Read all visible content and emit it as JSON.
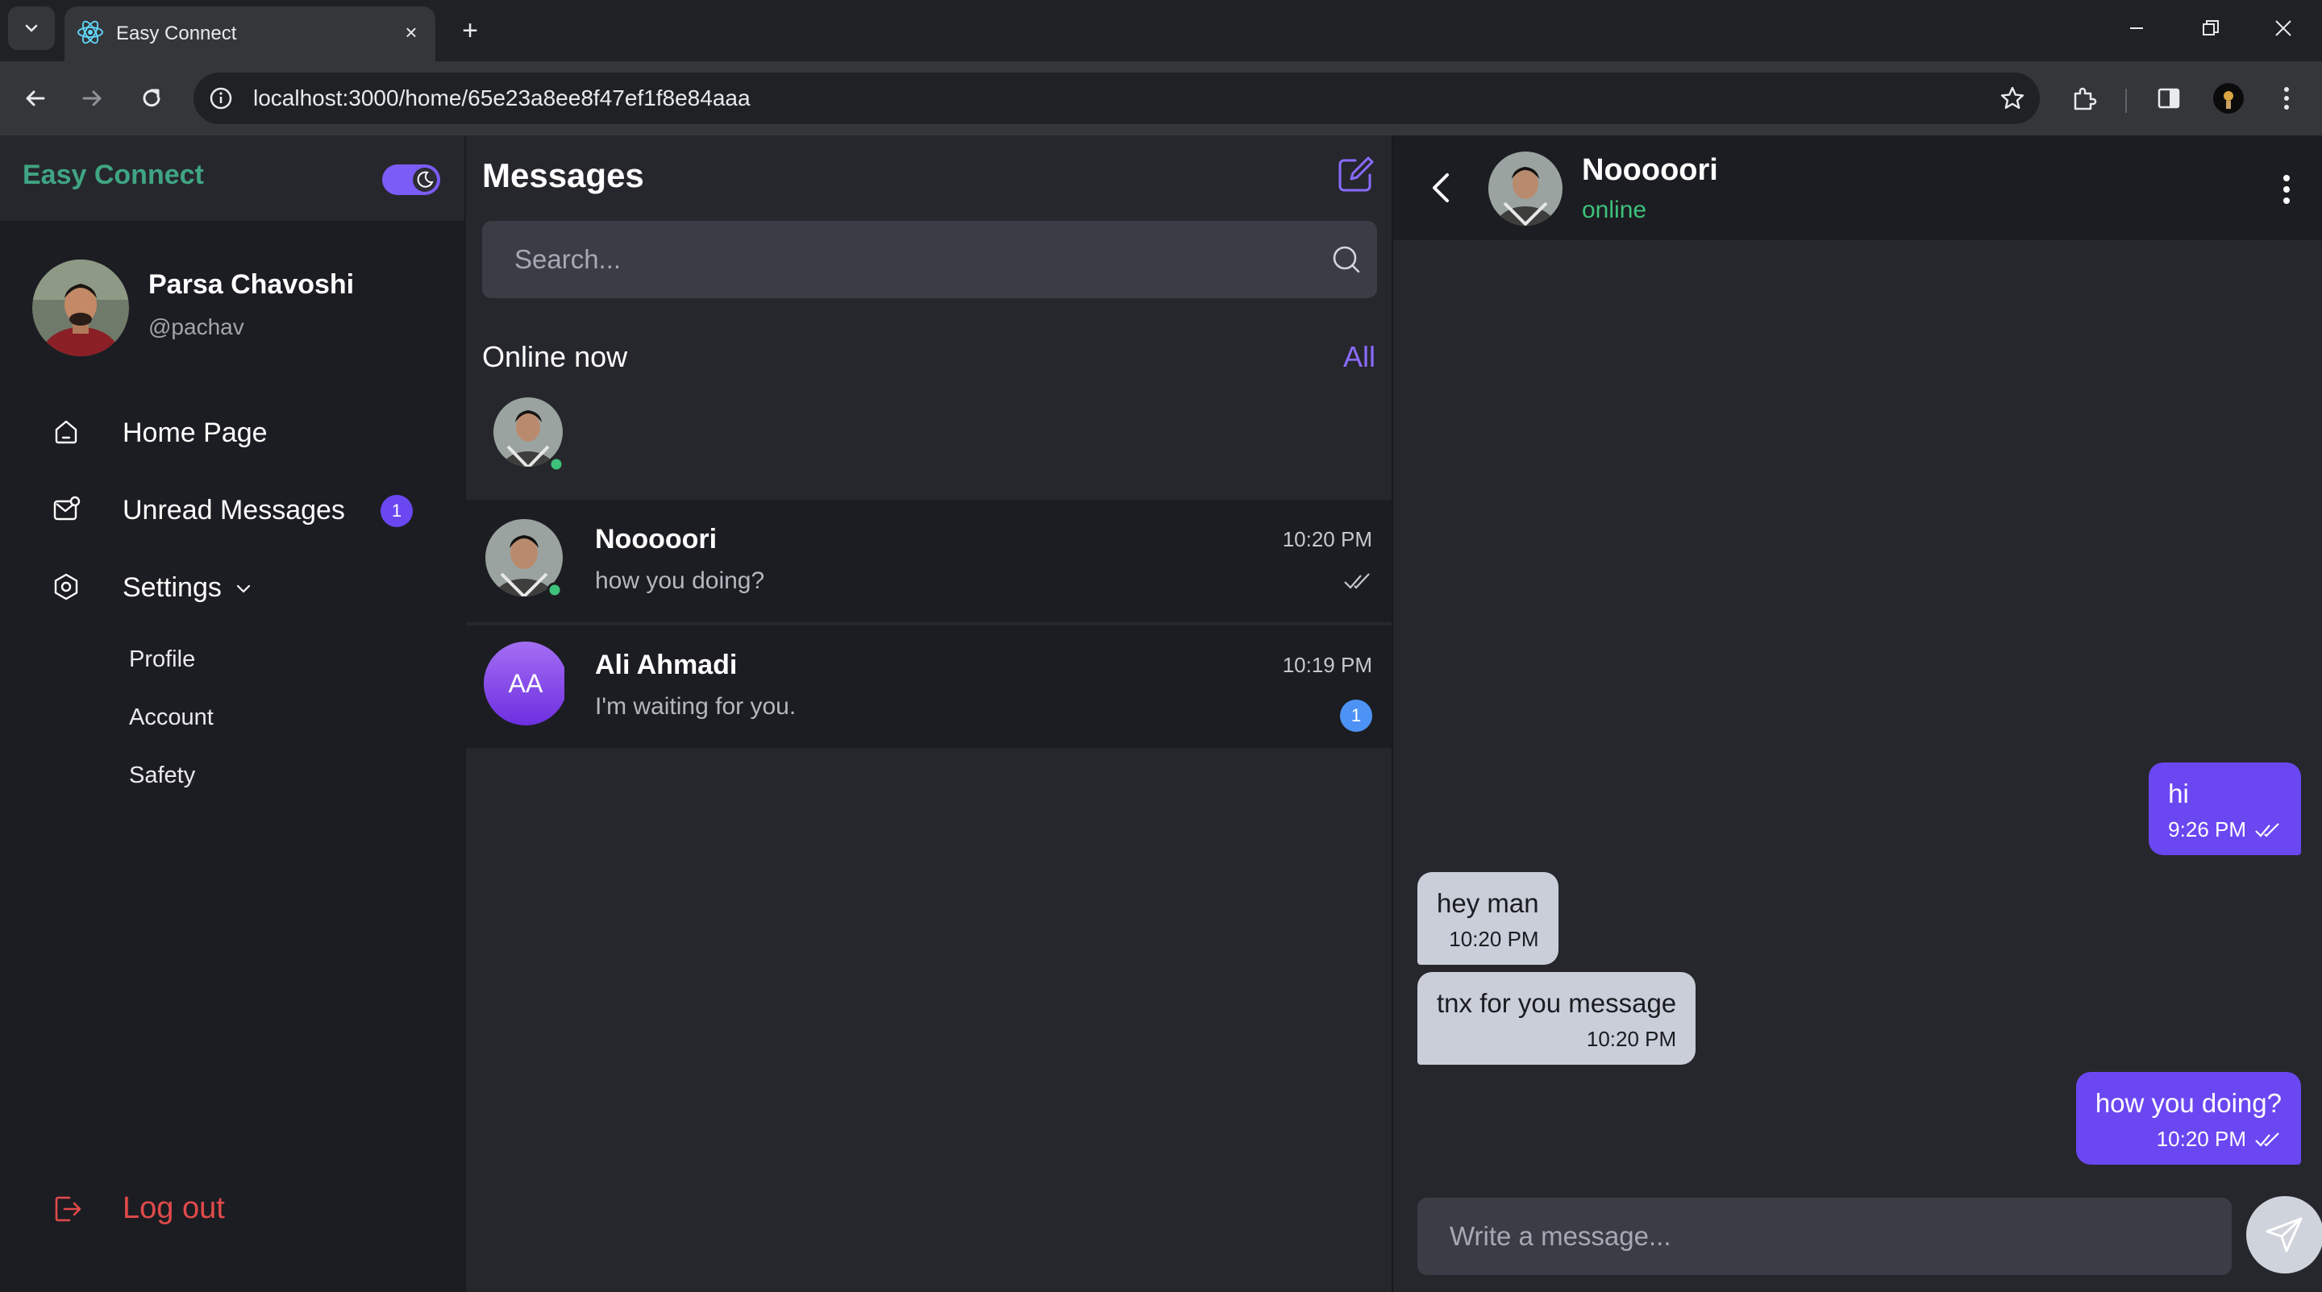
{
  "browser": {
    "tab_title": "Easy Connect",
    "new_tab": "+",
    "close": "×",
    "url": "localhost:3000/home/65e23a8ee8f47ef1f8e84aaa"
  },
  "sidebar": {
    "brand": "Easy Connect",
    "user": {
      "name": "Parsa Chavoshi",
      "handle": "@pachav"
    },
    "nav": {
      "home": "Home Page",
      "unread": "Unread Messages",
      "unread_count": "1",
      "settings": "Settings"
    },
    "settings_items": [
      "Profile",
      "Account",
      "Safety"
    ],
    "logout": "Log out"
  },
  "messages": {
    "title": "Messages",
    "search_placeholder": "Search...",
    "online_label": "Online now",
    "online_all": "All",
    "conversations": [
      {
        "name": "Nooooori",
        "preview": "how you doing?",
        "time": "10:20 PM",
        "status": "read"
      },
      {
        "name": "Ali Ahmadi",
        "initials": "AA",
        "preview": "I'm waiting for you.",
        "time": "10:19 PM",
        "unread": "1"
      }
    ]
  },
  "chat": {
    "name": "Nooooori",
    "status": "online",
    "messages": [
      {
        "dir": "out",
        "text": "hi",
        "time": "9:26 PM"
      },
      {
        "dir": "in",
        "text": "hey man",
        "time": "10:20 PM"
      },
      {
        "dir": "in",
        "text": "tnx for you message",
        "time": "10:20 PM"
      },
      {
        "dir": "out",
        "text": "how you doing?",
        "time": "10:20 PM"
      }
    ],
    "input_placeholder": "Write a message..."
  },
  "colors": {
    "accent": "#6b47f2",
    "brand": "#3fa582",
    "online": "#3ec17a",
    "logout": "#e24a4a",
    "unread_badge": "#4d93f5"
  },
  "icons": [
    "dropdown-icon",
    "react-favicon",
    "close-icon",
    "back-icon",
    "forward-icon",
    "reload-icon",
    "info-icon",
    "star-icon",
    "extensions-icon",
    "sidepanel-icon",
    "profile-icon",
    "kebab-icon",
    "moon-icon",
    "home-icon",
    "unread-icon",
    "settings-icon",
    "chevron-down-icon",
    "logout-icon",
    "compose-icon",
    "search-icon",
    "double-check-icon",
    "back-arrow-icon",
    "more-icon",
    "send-icon"
  ]
}
